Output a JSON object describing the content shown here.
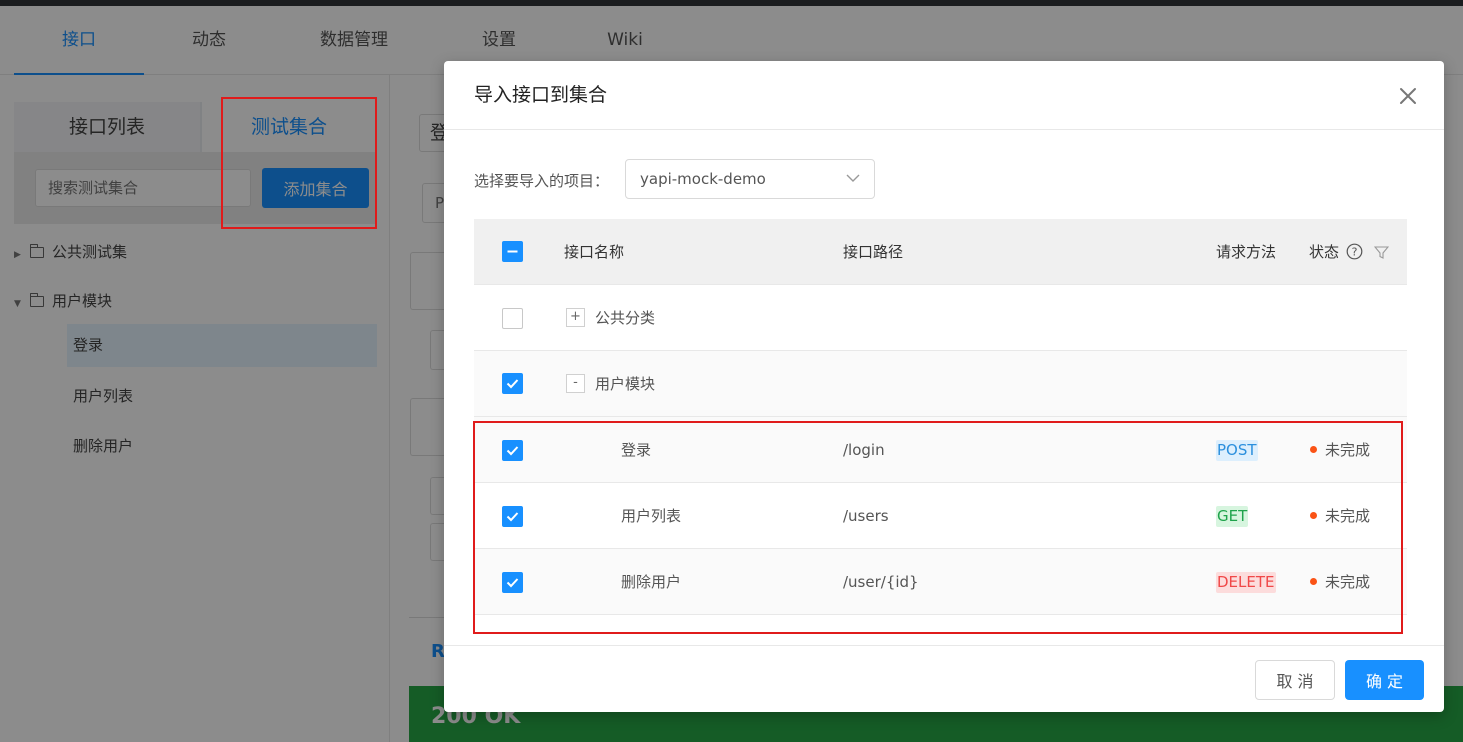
{
  "nav": {
    "tabs": [
      {
        "label": "接口",
        "active": true
      },
      {
        "label": "动态"
      },
      {
        "label": "数据管理"
      },
      {
        "label": "设置"
      },
      {
        "label": "Wiki"
      }
    ]
  },
  "sidebar": {
    "tabs": [
      {
        "label": "接口列表"
      },
      {
        "label": "测试集合"
      }
    ],
    "search_placeholder": "搜索测试集合",
    "add_button_label": "添加集合",
    "tree": [
      {
        "label": "公共测试集",
        "expanded": false
      },
      {
        "label": "用户模块",
        "expanded": true,
        "children": [
          {
            "label": "登录",
            "selected": true
          },
          {
            "label": "用户列表"
          },
          {
            "label": "删除用户"
          }
        ]
      }
    ]
  },
  "main": {
    "tab_label": "R",
    "status_text": "200 OK",
    "stub_text_1": "登",
    "stub_text_2": "P"
  },
  "modal": {
    "title": "导入接口到集合",
    "project_label": "选择要导入的项目：",
    "project_value": "yapi-mock-demo",
    "columns": {
      "name": "接口名称",
      "path": "接口路径",
      "method": "请求方法",
      "status": "状态"
    },
    "rows": [
      {
        "type": "category",
        "name": "公共分类",
        "expand": "+",
        "checked": false
      },
      {
        "type": "category",
        "name": "用户模块",
        "expand": "-",
        "checked": true
      },
      {
        "type": "api",
        "name": "登录",
        "path": "/login",
        "method": "POST",
        "status": "未完成",
        "checked": true
      },
      {
        "type": "api",
        "name": "用户列表",
        "path": "/users",
        "method": "GET",
        "status": "未完成",
        "checked": true
      },
      {
        "type": "api",
        "name": "删除用户",
        "path": "/user/{id}",
        "method": "DELETE",
        "status": "未完成",
        "checked": true
      }
    ],
    "cancel_label": "取 消",
    "ok_label": "确 定"
  },
  "colors": {
    "primary": "#1890ff",
    "highlight": "#e01b1b",
    "success": "#27a845",
    "status_dot": "#fa5316"
  }
}
